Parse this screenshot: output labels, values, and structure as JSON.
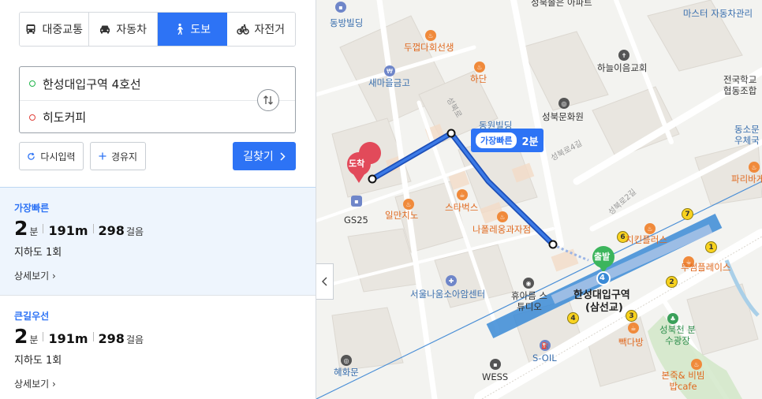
{
  "modes": [
    {
      "label": "대중교통",
      "icon": "bus-icon",
      "active": false
    },
    {
      "label": "자동차",
      "icon": "car-icon",
      "active": false
    },
    {
      "label": "도보",
      "icon": "walk-icon",
      "active": true
    },
    {
      "label": "자전거",
      "icon": "bicycle-icon",
      "active": false
    }
  ],
  "route": {
    "origin": "한성대입구역 4호선",
    "destination": "히도커피"
  },
  "buttons": {
    "reset": "다시입력",
    "waypoint": "경유지",
    "search": "길찾기"
  },
  "results": [
    {
      "title": "가장빠른",
      "time_value": "2",
      "time_unit": "분",
      "distance": "191m",
      "steps_value": "298",
      "steps_unit": "걸음",
      "sub": "지하도 1회",
      "detail": "상세보기",
      "selected": true
    },
    {
      "title": "큰길우선",
      "time_value": "2",
      "time_unit": "분",
      "distance": "191m",
      "steps_value": "298",
      "steps_unit": "걸음",
      "sub": "지하도 1회",
      "detail": "상세보기",
      "selected": false
    }
  ],
  "map": {
    "badge": {
      "tag": "가장빠른",
      "time": "2분"
    },
    "arrival_marker": "도착",
    "start_marker": "출발",
    "station": {
      "name_line1": "한성대입구역",
      "name_line2": "(삼선교)",
      "line_number": "4"
    },
    "exits": [
      "1",
      "2",
      "3",
      "4",
      "6",
      "7"
    ],
    "labels": {
      "seongbuk_apt": "성북솔은 아파트",
      "master_auto": "마스터 자동차관리",
      "dongbang": "동방빌딩",
      "dugeop": "두껍다회선생",
      "saemaeul": "새마을금고",
      "hadan": "하단",
      "haneul_church": "하늘이음교회",
      "national_school": "전국학교 협동조합",
      "dongsomun_post": "동소문 우체국",
      "seongbuk_culture": "성북문화원",
      "seongbuk_building": "동원빌딩",
      "road1": "성북로4길",
      "road2": "성북로2길",
      "road3": "성북로",
      "paris_baguette": "파리바게",
      "gs25": "GS25",
      "ilmanchino": "일만치노",
      "starbucks": "스타벅스",
      "napoleon": "나폴레옹과자점",
      "chikin_plus": "치킨플러스",
      "tusome": "투썸플레이스",
      "seoul_naum": "서울나움소아암센터",
      "hyuareum": "휴아름 스튜디오",
      "paikdabang": "빽다방",
      "seongbukcheon": "성북천 분수광장",
      "soil": "S-OIL",
      "wess": "WESS",
      "hyehwamun": "혜화문",
      "bonjuk": "본죽& 비빔밥cafe"
    }
  },
  "colors": {
    "accent": "#2d73f5",
    "route": "#1d4fb8",
    "subway": "#3a8ad6",
    "arrival": "#e24a5a",
    "start": "#3cb55c"
  }
}
